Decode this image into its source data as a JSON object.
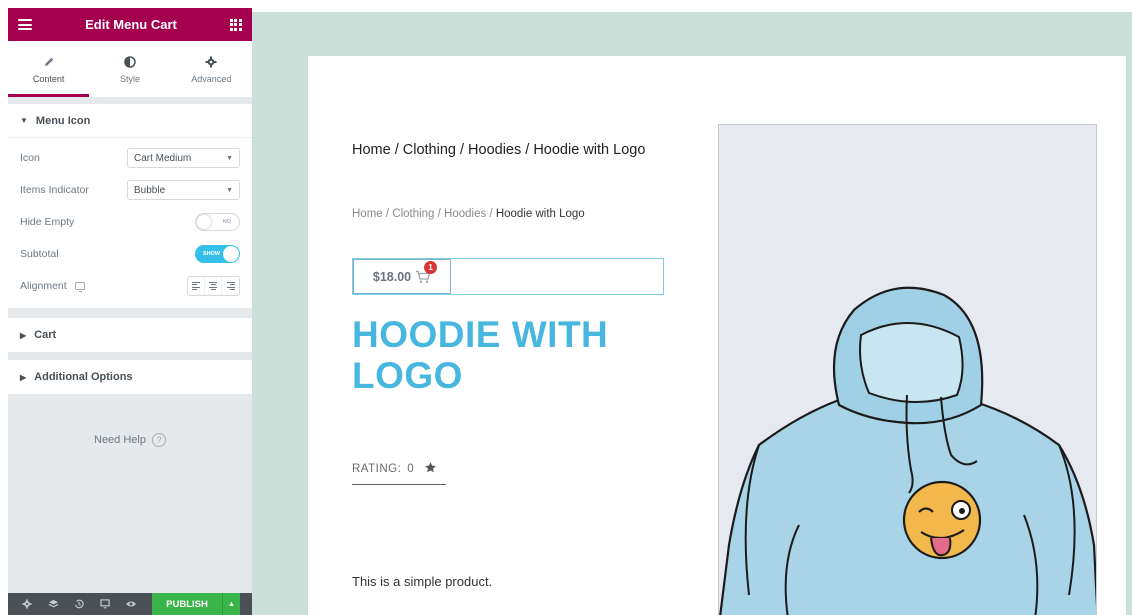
{
  "panel": {
    "title": "Edit Menu Cart",
    "tabs": [
      {
        "label": "Content",
        "icon": "pencil-icon"
      },
      {
        "label": "Style",
        "icon": "half-circle-icon"
      },
      {
        "label": "Advanced",
        "icon": "gear-icon"
      }
    ],
    "sections": {
      "menu_icon": "Menu Icon",
      "cart": "Cart",
      "additional": "Additional Options"
    },
    "controls": {
      "icon_label": "Icon",
      "icon_value": "Cart Medium",
      "indicator_label": "Items Indicator",
      "indicator_value": "Bubble",
      "hide_empty_label": "Hide Empty",
      "hide_empty_state": "NO",
      "subtotal_label": "Subtotal",
      "subtotal_state": "SHOW",
      "alignment_label": "Alignment"
    },
    "need_help": "Need Help",
    "help_glyph": "?",
    "publish": "PUBLISH",
    "accent_color": "#a4004f",
    "publish_color": "#39b54a"
  },
  "preview": {
    "breadcrumb_large": "Home / Clothing / Hoodies / Hoodie with Logo",
    "breadcrumb_small_links": "Home / Clothing / Hoodies / ",
    "breadcrumb_small_current": "Hoodie with Logo",
    "cart_price": "$18.00",
    "cart_count": "1",
    "product_title": "HOODIE WITH LOGO",
    "rating_label": "RATING:",
    "rating_value": "0",
    "short_description": "This is a simple product.",
    "title_color": "#47b7e0",
    "background_color": "#cbe0d8"
  }
}
